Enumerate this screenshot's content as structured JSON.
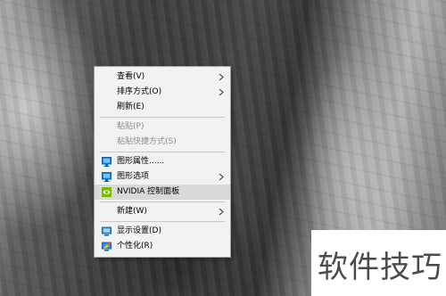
{
  "context_menu": {
    "items": [
      {
        "label": "查看(V)"
      },
      {
        "label": "排序方式(O)"
      },
      {
        "label": "刷新(E)"
      },
      {
        "label": "粘贴(P)"
      },
      {
        "label": "粘贴快捷方式(S)"
      },
      {
        "label": "图形属性......",
        "icon": "monitor-icon"
      },
      {
        "label": "图形选项",
        "icon": "monitor-icon"
      },
      {
        "label": "NVIDIA 控制面板",
        "icon": "nvidia-icon"
      },
      {
        "label": "新建(W)"
      },
      {
        "label": "显示设置(D)",
        "icon": "display-icon"
      },
      {
        "label": "个性化(R)",
        "icon": "personalize-icon"
      }
    ],
    "submenu_arrow": "›",
    "colors": {
      "background": "#f2f2f2",
      "hover": "#d9d9d9",
      "disabled_text": "#8c8c8c"
    }
  },
  "watermark": {
    "text": "软件技巧"
  }
}
